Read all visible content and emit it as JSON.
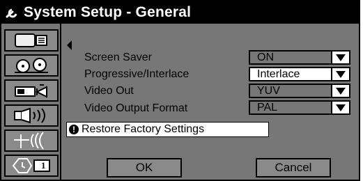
{
  "window": {
    "title": "System Setup - General"
  },
  "sidebar": {
    "items": [
      {
        "icon": "tv-menu-icon"
      },
      {
        "icon": "film-reels-icon"
      },
      {
        "icon": "camera-icon"
      },
      {
        "icon": "speaker-icon"
      },
      {
        "icon": "antenna-icon"
      },
      {
        "icon": "clock-icon",
        "badge": "1"
      }
    ]
  },
  "settings": [
    {
      "label": "Screen Saver",
      "value": "ON"
    },
    {
      "label": "Progressive/Interlace",
      "value": "Interlace"
    },
    {
      "label": "Video Out",
      "value": "YUV"
    },
    {
      "label": "Video Output Format",
      "value": "PAL"
    }
  ],
  "restore": {
    "label": "Restore Factory Settings"
  },
  "buttons": {
    "ok": "OK",
    "cancel": "Cancel"
  },
  "colors": {
    "background": "#777777",
    "titlebar": "#000000",
    "selected": "#ffffff"
  }
}
